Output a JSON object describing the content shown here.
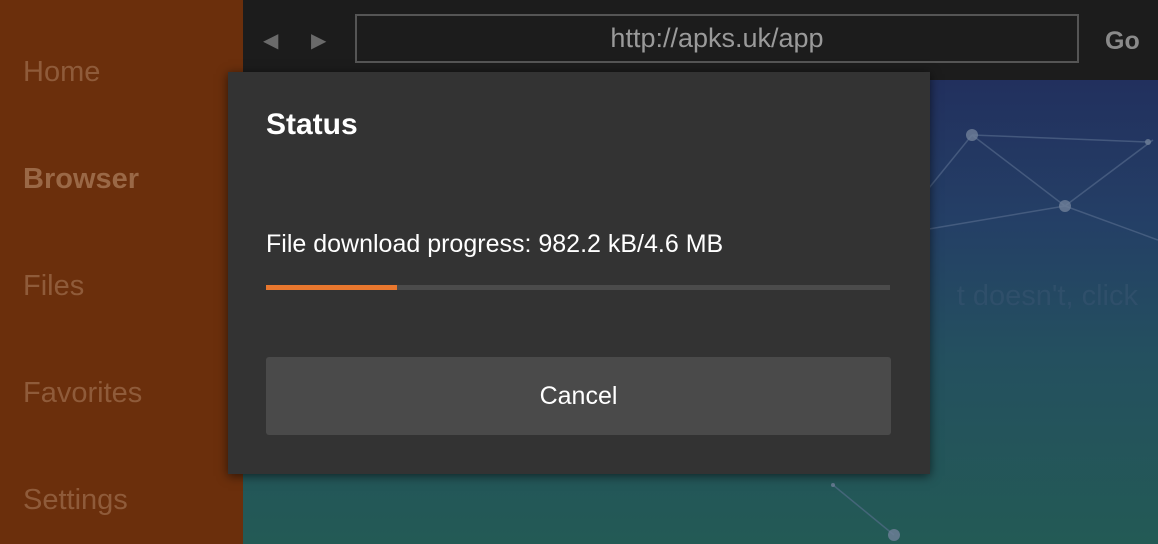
{
  "sidebar": {
    "items": [
      {
        "label": "Home"
      },
      {
        "label": "Browser"
      },
      {
        "label": "Files"
      },
      {
        "label": "Favorites"
      },
      {
        "label": "Settings"
      }
    ]
  },
  "toolbar": {
    "back_icon": "◀",
    "forward_icon": "▶",
    "url": "http://apks.uk/app",
    "go_label": "Go"
  },
  "content": {
    "partial_text": "t doesn't, click"
  },
  "dialog": {
    "title": "Status",
    "progress_text": "File download progress: 982.2 kB/4.6 MB",
    "progress_fraction": 0.21,
    "cancel_label": "Cancel"
  },
  "colors": {
    "sidebar_bg": "#6b2f0c",
    "accent_progress": "#e8772e",
    "dialog_bg": "#333333"
  }
}
